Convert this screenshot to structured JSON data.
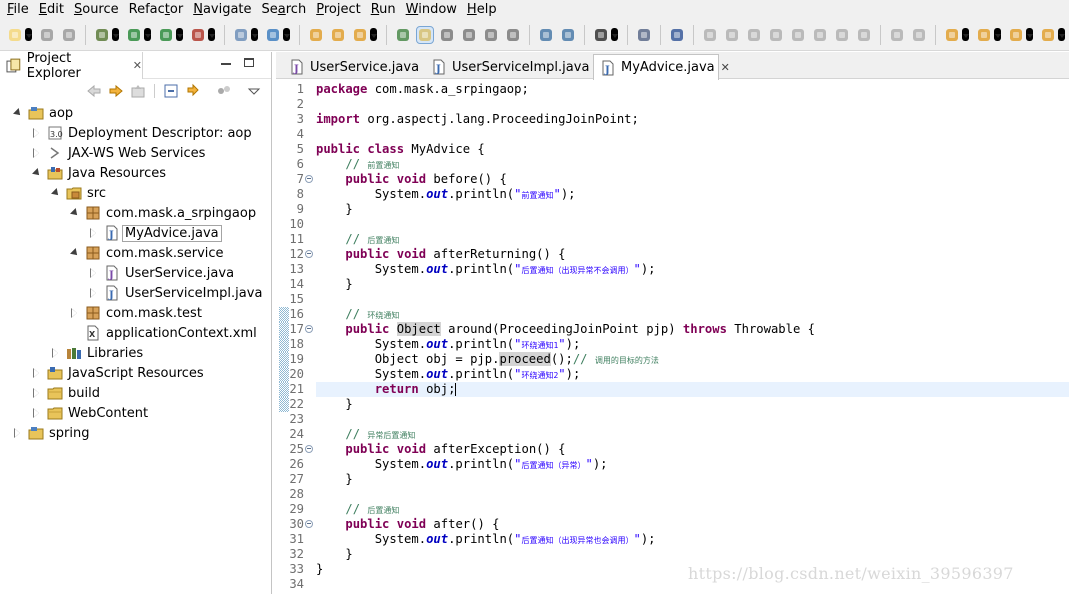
{
  "menu": [
    {
      "u": "F",
      "rest": "ile"
    },
    {
      "u": "E",
      "rest": "dit"
    },
    {
      "u": "S",
      "rest": "ource"
    },
    {
      "pre": "Refac",
      "u": "t",
      "rest": "or"
    },
    {
      "u": "N",
      "rest": "avigate"
    },
    {
      "pre": "Se",
      "u": "a",
      "rest": "rch"
    },
    {
      "u": "P",
      "rest": "roject"
    },
    {
      "u": "R",
      "rest": "un"
    },
    {
      "u": "W",
      "rest": "indow"
    },
    {
      "u": "H",
      "rest": "elp"
    }
  ],
  "explorer": {
    "title": "Project Explorer",
    "close_glyph": "✕",
    "tree": [
      {
        "label": "aop",
        "depth": 0,
        "twisty": "open",
        "icon": "project-icon"
      },
      {
        "label": "Deployment Descriptor: aop",
        "depth": 1,
        "twisty": "closed",
        "icon": "deployment-descriptor-icon"
      },
      {
        "label": "JAX-WS Web Services",
        "depth": 1,
        "twisty": "closed",
        "icon": "web-services-icon"
      },
      {
        "label": "Java Resources",
        "depth": 1,
        "twisty": "open",
        "icon": "java-resources-icon"
      },
      {
        "label": "src",
        "depth": 2,
        "twisty": "open",
        "icon": "source-folder-icon"
      },
      {
        "label": "com.mask.a_srpingaop",
        "depth": 3,
        "twisty": "open",
        "icon": "package-icon"
      },
      {
        "label": "MyAdvice.java",
        "depth": 4,
        "twisty": "closed",
        "icon": "java-file-icon",
        "selected": true
      },
      {
        "label": "com.mask.service",
        "depth": 3,
        "twisty": "open",
        "icon": "package-icon"
      },
      {
        "label": "UserService.java",
        "depth": 4,
        "twisty": "closed",
        "icon": "java-interface-file-icon"
      },
      {
        "label": "UserServiceImpl.java",
        "depth": 4,
        "twisty": "closed",
        "icon": "java-file-icon"
      },
      {
        "label": "com.mask.test",
        "depth": 3,
        "twisty": "closed",
        "icon": "package-icon"
      },
      {
        "label": "applicationContext.xml",
        "depth": 3,
        "twisty": "none",
        "icon": "xml-file-icon"
      },
      {
        "label": "Libraries",
        "depth": 2,
        "twisty": "closed",
        "icon": "libraries-icon"
      },
      {
        "label": "JavaScript Resources",
        "depth": 1,
        "twisty": "closed",
        "icon": "javascript-resources-icon"
      },
      {
        "label": "build",
        "depth": 1,
        "twisty": "closed",
        "icon": "folder-icon"
      },
      {
        "label": "WebContent",
        "depth": 1,
        "twisty": "closed",
        "icon": "folder-icon"
      },
      {
        "label": "spring",
        "depth": 0,
        "twisty": "closed",
        "icon": "project-icon"
      }
    ]
  },
  "editor": {
    "tabs": [
      {
        "label": "UserService.java",
        "icon": "java-interface-file-icon",
        "active": false
      },
      {
        "label": "UserServiceImpl.java",
        "icon": "java-file-icon",
        "active": false
      },
      {
        "label": "MyAdvice.java",
        "icon": "java-file-icon",
        "active": true,
        "close": "✕"
      }
    ],
    "current_line": 21,
    "fold_lines": [
      7,
      12,
      17,
      25,
      30
    ],
    "change_lines": [
      16,
      17,
      18,
      19,
      20,
      21,
      22
    ],
    "lines": [
      [
        {
          "t": "package",
          "c": "kw"
        },
        {
          "t": " com.mask.a_srpingaop;"
        }
      ],
      [],
      [
        {
          "t": "import",
          "c": "kw"
        },
        {
          "t": " org.aspectj.lang.ProceedingJoinPoint;"
        }
      ],
      [],
      [
        {
          "t": "public",
          "c": "kw"
        },
        {
          "t": " "
        },
        {
          "t": "class",
          "c": "kw"
        },
        {
          "t": " MyAdvice {"
        }
      ],
      [
        {
          "t": "    "
        },
        {
          "t": "// ",
          "c": "cm"
        },
        {
          "t": "前置通知",
          "c": "cm cm-cjk"
        }
      ],
      [
        {
          "t": "    "
        },
        {
          "t": "public",
          "c": "kw"
        },
        {
          "t": " "
        },
        {
          "t": "void",
          "c": "kw"
        },
        {
          "t": " before() {"
        }
      ],
      [
        {
          "t": "        System."
        },
        {
          "t": "out",
          "c": "fld"
        },
        {
          "t": ".println("
        },
        {
          "t": "\"",
          "c": "st"
        },
        {
          "t": "前置通知",
          "c": "st st-cjk"
        },
        {
          "t": "\"",
          "c": "st"
        },
        {
          "t": ");"
        }
      ],
      [
        {
          "t": "    }"
        }
      ],
      [],
      [
        {
          "t": "    "
        },
        {
          "t": "// ",
          "c": "cm"
        },
        {
          "t": "后置通知",
          "c": "cm cm-cjk"
        }
      ],
      [
        {
          "t": "    "
        },
        {
          "t": "public",
          "c": "kw"
        },
        {
          "t": " "
        },
        {
          "t": "void",
          "c": "kw"
        },
        {
          "t": " afterReturning() {"
        }
      ],
      [
        {
          "t": "        System."
        },
        {
          "t": "out",
          "c": "fld"
        },
        {
          "t": ".println("
        },
        {
          "t": "\"",
          "c": "st"
        },
        {
          "t": "后置通知（出现异常不会调用）",
          "c": "st st-cjk"
        },
        {
          "t": "\"",
          "c": "st"
        },
        {
          "t": ");"
        }
      ],
      [
        {
          "t": "    }"
        }
      ],
      [],
      [
        {
          "t": "    "
        },
        {
          "t": "// ",
          "c": "cm"
        },
        {
          "t": "环绕通知",
          "c": "cm cm-cjk"
        }
      ],
      [
        {
          "t": "    "
        },
        {
          "t": "public",
          "c": "kw"
        },
        {
          "t": " "
        },
        {
          "t": "Object",
          "c": "occ"
        },
        {
          "t": " around(ProceedingJoinPoint pjp) "
        },
        {
          "t": "throws",
          "c": "kw"
        },
        {
          "t": " Throwable {"
        }
      ],
      [
        {
          "t": "        System."
        },
        {
          "t": "out",
          "c": "fld"
        },
        {
          "t": ".println("
        },
        {
          "t": "\"",
          "c": "st"
        },
        {
          "t": "环绕通知1",
          "c": "st st-cjk"
        },
        {
          "t": "\"",
          "c": "st"
        },
        {
          "t": ");"
        }
      ],
      [
        {
          "t": "        Object obj = pjp."
        },
        {
          "t": "proceed",
          "c": "occ"
        },
        {
          "t": "();"
        },
        {
          "t": "// ",
          "c": "cm"
        },
        {
          "t": "调用的目标的方法",
          "c": "cm cm-cjk"
        }
      ],
      [
        {
          "t": "        System."
        },
        {
          "t": "out",
          "c": "fld"
        },
        {
          "t": ".println("
        },
        {
          "t": "\"",
          "c": "st"
        },
        {
          "t": "环绕通知2",
          "c": "st st-cjk"
        },
        {
          "t": "\"",
          "c": "st"
        },
        {
          "t": ");"
        }
      ],
      [
        {
          "t": "        "
        },
        {
          "t": "return",
          "c": "kw"
        },
        {
          "t": " obj;"
        },
        {
          "t": "",
          "c": "caret"
        }
      ],
      [
        {
          "t": "    }"
        }
      ],
      [],
      [
        {
          "t": "    "
        },
        {
          "t": "// ",
          "c": "cm"
        },
        {
          "t": "异常后置通知",
          "c": "cm cm-cjk"
        }
      ],
      [
        {
          "t": "    "
        },
        {
          "t": "public",
          "c": "kw"
        },
        {
          "t": " "
        },
        {
          "t": "void",
          "c": "kw"
        },
        {
          "t": " afterException() {"
        }
      ],
      [
        {
          "t": "        System."
        },
        {
          "t": "out",
          "c": "fld"
        },
        {
          "t": ".println("
        },
        {
          "t": "\"",
          "c": "st"
        },
        {
          "t": "后置通知（异常）",
          "c": "st st-cjk"
        },
        {
          "t": "\"",
          "c": "st"
        },
        {
          "t": ");"
        }
      ],
      [
        {
          "t": "    }"
        }
      ],
      [],
      [
        {
          "t": "    "
        },
        {
          "t": "// ",
          "c": "cm"
        },
        {
          "t": "后置通知",
          "c": "cm cm-cjk"
        }
      ],
      [
        {
          "t": "    "
        },
        {
          "t": "public",
          "c": "kw"
        },
        {
          "t": " "
        },
        {
          "t": "void",
          "c": "kw"
        },
        {
          "t": " after() {"
        }
      ],
      [
        {
          "t": "        System."
        },
        {
          "t": "out",
          "c": "fld"
        },
        {
          "t": ".println("
        },
        {
          "t": "\"",
          "c": "st"
        },
        {
          "t": "后置通知（出现异常也会调用）",
          "c": "st st-cjk"
        },
        {
          "t": "\"",
          "c": "st"
        },
        {
          "t": ");"
        }
      ],
      [
        {
          "t": "    }"
        }
      ],
      [
        {
          "t": "}"
        }
      ],
      []
    ]
  },
  "watermark": "https://blog.csdn.net/weixin_39596397",
  "colors": {
    "keyword": "#7f0055",
    "comment": "#3f7f5f",
    "string": "#2a00ff",
    "field": "#0000c0",
    "current_line": "#e8f2fe",
    "selection_outline": "#a4a4a4",
    "chrome": "#f0f0f0"
  }
}
